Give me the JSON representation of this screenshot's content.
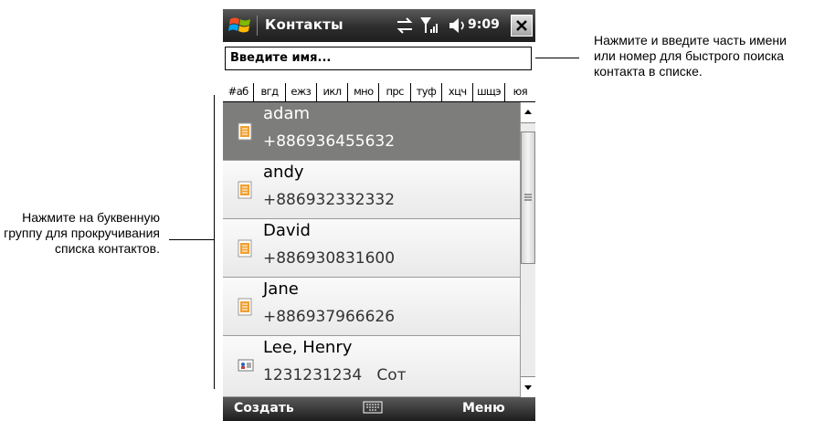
{
  "annotations": {
    "right": "Нажмите и введите часть имени или номер для быстрого поиска контакта в списке.",
    "left": "Нажмите на буквенную группу для прокручивания списка контактов."
  },
  "titlebar": {
    "title": "Контакты",
    "time": "9:09"
  },
  "search": {
    "placeholder": "Введите имя..."
  },
  "alpha_groups": [
    "#аб",
    "вгд",
    "ежз",
    "икл",
    "мно",
    "прс",
    "туф",
    "хцч",
    "шщэ",
    "юя"
  ],
  "contacts": [
    {
      "name": "adam",
      "phone": "+886936455632",
      "selected": true,
      "icon": "contact-card-icon"
    },
    {
      "name": "andy",
      "phone": "+886932332332",
      "selected": false,
      "icon": "contact-card-icon"
    },
    {
      "name": "David",
      "phone": "+886930831600",
      "selected": false,
      "icon": "contact-card-icon"
    },
    {
      "name": "Jane",
      "phone": "+886937966626",
      "selected": false,
      "icon": "contact-card-icon"
    },
    {
      "name": "Lee, Henry",
      "phone": "1231231234   Сот",
      "selected": false,
      "icon": "business-card-icon"
    }
  ],
  "softkeys": {
    "left": "Создать",
    "right": "Меню"
  },
  "colors": {
    "titlebar": "#2d2d2d",
    "selected_row": "#7d7d7c",
    "contact_icon": "#f0a030"
  }
}
